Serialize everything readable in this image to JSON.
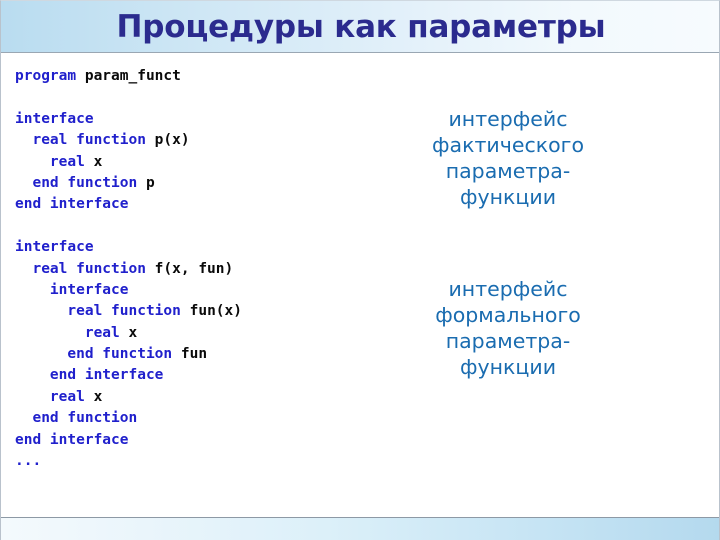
{
  "slide": {
    "title": "Процедуры как параметры",
    "colors": {
      "title_text": "#2b2b8e",
      "header_gradient_start": "#b9dcf0",
      "header_gradient_end": "#f7fbfe",
      "code_keyword": "#2020cc",
      "code_identifier": "#0a0a0a",
      "annotation_text": "#1a6cb0",
      "footer_gradient_start": "#f4fafd",
      "footer_gradient_end": "#b4d9ee",
      "background": "#ffffff"
    }
  },
  "code": {
    "language": "Fortran",
    "lines": [
      [
        {
          "t": "program",
          "k": true
        },
        {
          "t": " param_funct",
          "k": false
        }
      ],
      [
        {
          "t": "",
          "k": false
        }
      ],
      [
        {
          "t": "interface",
          "k": true
        }
      ],
      [
        {
          "t": "  real function",
          "k": true
        },
        {
          "t": " p(x)",
          "k": false
        }
      ],
      [
        {
          "t": "    real",
          "k": true
        },
        {
          "t": " x",
          "k": false
        }
      ],
      [
        {
          "t": "  end function",
          "k": true
        },
        {
          "t": " p",
          "k": false
        }
      ],
      [
        {
          "t": "end interface",
          "k": true
        }
      ],
      [
        {
          "t": "",
          "k": false
        }
      ],
      [
        {
          "t": "interface",
          "k": true
        }
      ],
      [
        {
          "t": "  real function",
          "k": true
        },
        {
          "t": " f(x, fun)",
          "k": false
        }
      ],
      [
        {
          "t": "    interface",
          "k": true
        }
      ],
      [
        {
          "t": "      real function",
          "k": true
        },
        {
          "t": " fun(x)",
          "k": false
        }
      ],
      [
        {
          "t": "        real",
          "k": true
        },
        {
          "t": " x",
          "k": false
        }
      ],
      [
        {
          "t": "      end function",
          "k": true
        },
        {
          "t": " fun",
          "k": false
        }
      ],
      [
        {
          "t": "    end interface",
          "k": true
        }
      ],
      [
        {
          "t": "    real",
          "k": true
        },
        {
          "t": " x",
          "k": false
        }
      ],
      [
        {
          "t": "  end function",
          "k": true
        }
      ],
      [
        {
          "t": "end interface",
          "k": true
        }
      ],
      [
        {
          "t": "...",
          "k": true
        }
      ]
    ],
    "plain_text": "program param_funct\n\ninterface\n  real function p(x)\n    real x\n  end function p\nend interface\n\ninterface\n  real function f(x, fun)\n    interface\n      real function fun(x)\n        real x\n      end function fun\n    end interface\n    real x\n  end function\nend interface\n..."
  },
  "annotations": [
    {
      "id": "actual-parameter",
      "lines": [
        "интерфейс",
        "фактического",
        "параметра-",
        "функции"
      ],
      "text": "интерфейс фактического параметра-функции"
    },
    {
      "id": "formal-parameter",
      "lines": [
        "интерфейс",
        "формального",
        "параметра-",
        "функции"
      ],
      "text": "интерфейс формального параметра-функции"
    }
  ]
}
